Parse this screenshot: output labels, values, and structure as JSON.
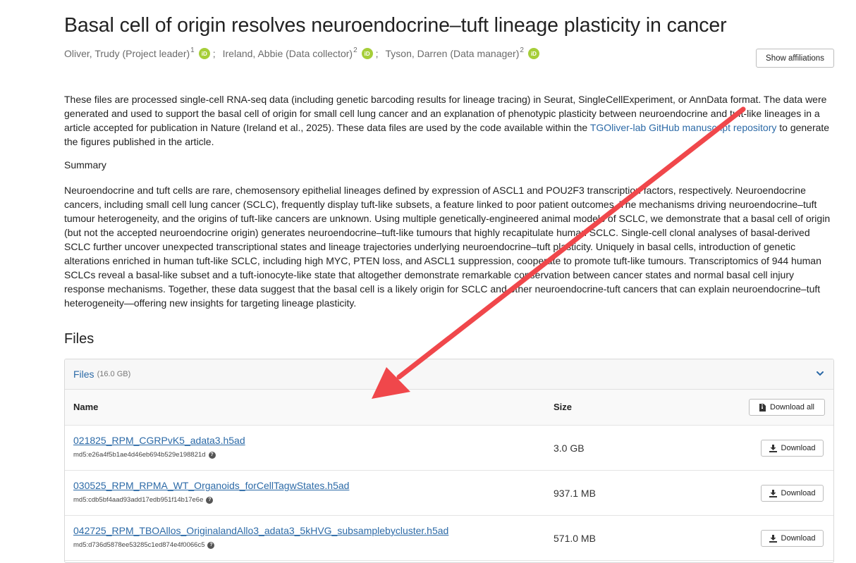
{
  "record": {
    "title": "Basal cell of origin resolves neuroendocrine–tuft lineage plasticity in cancer",
    "creators": [
      {
        "name": "Oliver, Trudy (Project leader)",
        "sup": "1"
      },
      {
        "name": "Ireland, Abbie (Data collector)",
        "sup": "2"
      },
      {
        "name": "Tyson, Darren (Data manager)",
        "sup": "2"
      }
    ],
    "creator_separator": ";",
    "orcid_icon_text": "iD",
    "show_affiliations_label": "Show affiliations"
  },
  "description": {
    "text_before_link": "These files are processed single-cell RNA-seq data (including genetic barcoding results for lineage tracing) in Seurat, SingleCellExperiment, or AnnData format. The data were generated and used to support the basal cell of origin for small cell lung cancer and an explanation of phenotypic plasticity between neuroendocrine and tuft-like lineages in a article accepted for publication in Nature (Ireland et al., 2025). These data files are used by the code available within the ",
    "link_text": "TGOliver-lab GitHub manuscript repository",
    "text_after_link": " to generate the figures published in the article.",
    "summary_heading": "Summary",
    "summary_text": "Neuroendocrine and tuft cells are rare, chemosensory epithelial lineages defined by expression of ASCL1 and POU2F3 transcription factors, respectively. Neuroendocrine cancers, including small cell lung cancer (SCLC), frequently display tuft-like subsets, a feature linked to poor patient outcomes. The mechanisms driving neuroendocrine–tuft tumour heterogeneity, and the origins of tuft-like cancers are unknown. Using multiple genetically-engineered animal models of SCLC, we demonstrate that a basal cell of origin (but not the accepted neuroendocrine origin) generates neuroendocrine–tuft-like tumours that highly recapitulate human SCLC. Single-cell clonal analyses of basal-derived SCLC further uncover unexpected transcriptional states and lineage trajectories underlying neuroendocrine–tuft plasticity. Uniquely in basal cells, introduction of genetic alterations enriched in human tuft-like SCLC, including high MYC, PTEN loss, and ASCL1 suppression, cooperate to promote tuft-like tumours. Transcriptomics of 944 human SCLCs reveal a basal-like subset and a tuft-ionocyte-like state that altogether demonstrate remarkable conservation between cancer states and normal basal cell injury response mechanisms. Together, these data suggest that the basal cell is a likely origin for SCLC and other neuroendocrine-tuft cancers that can explain neuroendocrine–tuft heterogeneity—offering new insights for targeting lineage plasticity."
  },
  "files": {
    "heading": "Files",
    "panel_label": "Files",
    "panel_size": "(16.0 GB)",
    "col_name": "Name",
    "col_size": "Size",
    "download_all_label": "Download all",
    "download_label": "Download",
    "rows": [
      {
        "name": "021825_RPM_CGRPvK5_adata3.h5ad",
        "md5": "md5:e26a4f5b1ae4d46eb694b529e198821d",
        "size": "3.0 GB"
      },
      {
        "name": "030525_RPM_RPMA_WT_Organoids_forCellTagwStates.h5ad",
        "md5": "md5:cdb5bf4aad93add17edb951f14b17e6e",
        "size": "937.1 MB"
      },
      {
        "name": "042725_RPM_TBOAllos_OriginalandAllo3_adata3_5kHVG_subsamplebycluster.h5ad",
        "md5": "md5:d736d5878ee53285c1ed874e4f0066c5",
        "size": "571.0 MB"
      }
    ]
  },
  "annotation": {
    "arrow_color": "#f0474b"
  }
}
